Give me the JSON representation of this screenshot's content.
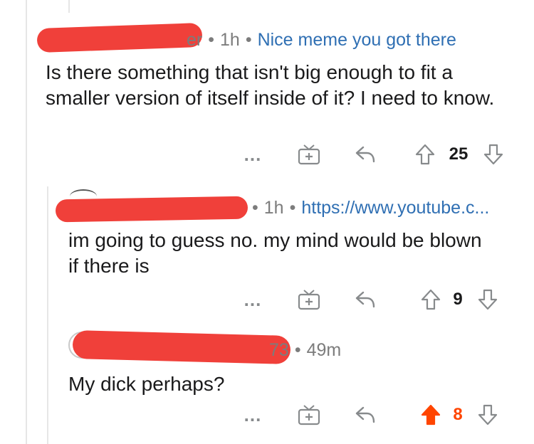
{
  "comments": [
    {
      "author_fragment": "er",
      "age": "1h",
      "flair": "Nice meme you got there",
      "text": "Is there something that isn't big enough to fit a smaller version of itself inside of it? I need to know.",
      "score": "25",
      "voted": "none"
    },
    {
      "author_fragment": "",
      "age": "1h",
      "flair": "https://www.youtube.c...",
      "text": "im going to guess no. my mind would be blown if there is",
      "score": "9",
      "voted": "none"
    },
    {
      "author_fragment": "73",
      "age": "49m",
      "flair": "",
      "text": "My dick perhaps?",
      "score": "8",
      "voted": "up"
    }
  ],
  "icons": {
    "more": "more-options-icon",
    "award": "award-gift-icon",
    "reply": "reply-arrow-icon",
    "upvote": "upvote-arrow-icon",
    "downvote": "downvote-arrow-icon"
  },
  "colors": {
    "upvote_active": "#ff4500",
    "redaction": "#f0403a",
    "flair": "#2f6fb3",
    "meta": "#7c7c7c"
  },
  "more_label": "..."
}
